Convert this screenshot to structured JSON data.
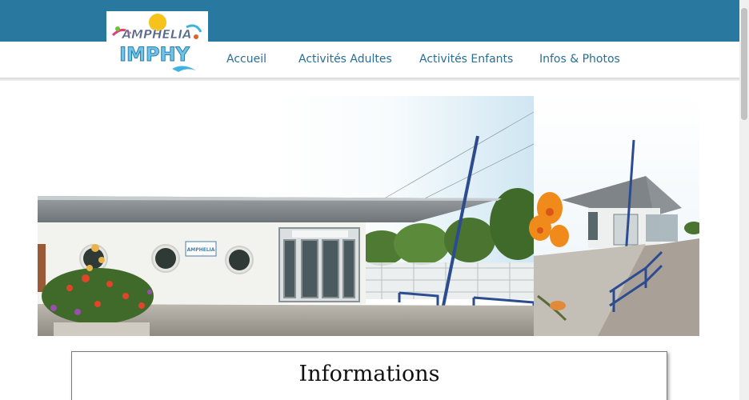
{
  "logo": {
    "text_top": "AMPHELIA",
    "text_bottom": "IMPHY"
  },
  "nav": {
    "items": [
      {
        "label": "Accueil"
      },
      {
        "label": "Activités Adultes"
      },
      {
        "label": "Activités Enfants"
      },
      {
        "label": "Infos & Photos"
      }
    ]
  },
  "hero": {
    "sign_text": "AMPHELIA"
  },
  "info": {
    "title": "Informations"
  },
  "colors": {
    "header": "#2878a0",
    "nav_text": "#2a6e94"
  }
}
